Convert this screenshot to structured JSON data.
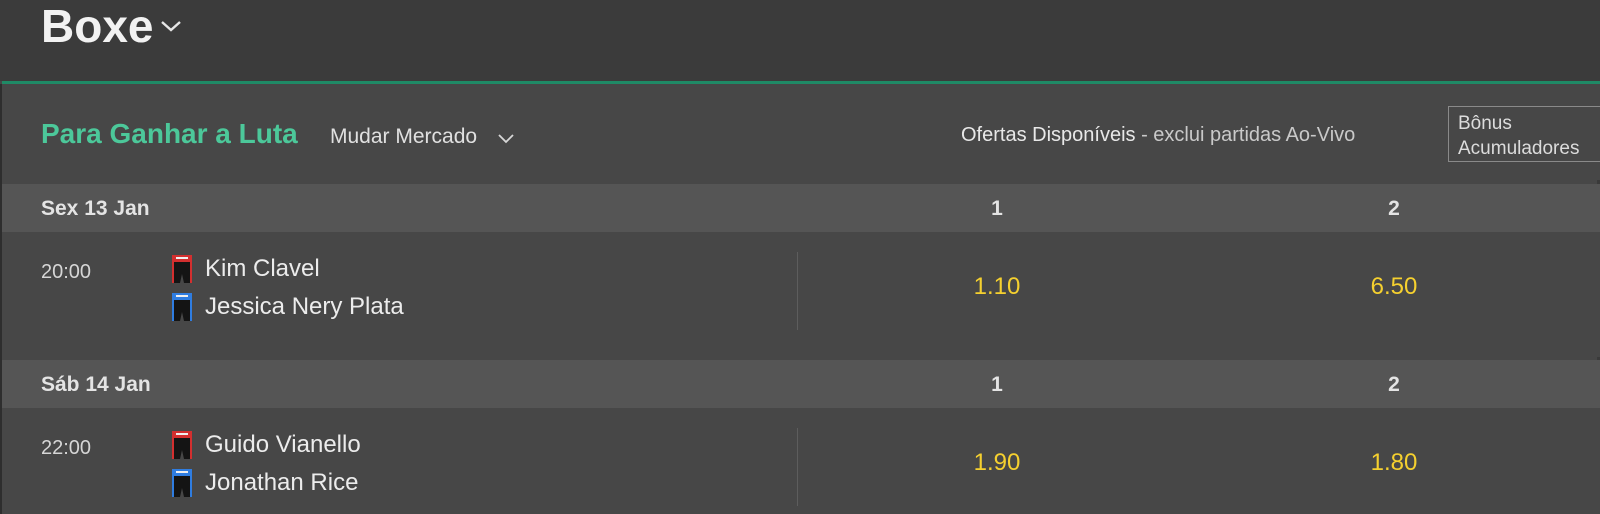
{
  "header": {
    "sport_title": "Boxe",
    "chevron_icon": "chevron-down-icon"
  },
  "market": {
    "title": "Para Ganhar a Luta",
    "change_label": "Mudar Mercado",
    "offers_label": "Ofertas Disponíveis",
    "offers_note": "- exclui partidas Ao-Vivo",
    "bonus_line1": "Bônus",
    "bonus_line2": "Acumuladores"
  },
  "colors": {
    "accent_green": "#4cc89a",
    "odds_yellow": "#f5d02f",
    "header_line": "#1f8a66",
    "red_corner": "#d32f2f",
    "blue_corner": "#2f7de1"
  },
  "days": [
    {
      "date": "Sex 13 Jan",
      "col1": "1",
      "col2": "2",
      "events": [
        {
          "time": "20:00",
          "fighter1": "Kim Clavel",
          "fighter2": "Jessica Nery Plata",
          "odds1": "1.10",
          "odds2": "6.50"
        }
      ]
    },
    {
      "date": "Sáb 14 Jan",
      "col1": "1",
      "col2": "2",
      "events": [
        {
          "time": "22:00",
          "fighter1": "Guido Vianello",
          "fighter2": "Jonathan Rice",
          "odds1": "1.90",
          "odds2": "1.80"
        }
      ]
    }
  ]
}
